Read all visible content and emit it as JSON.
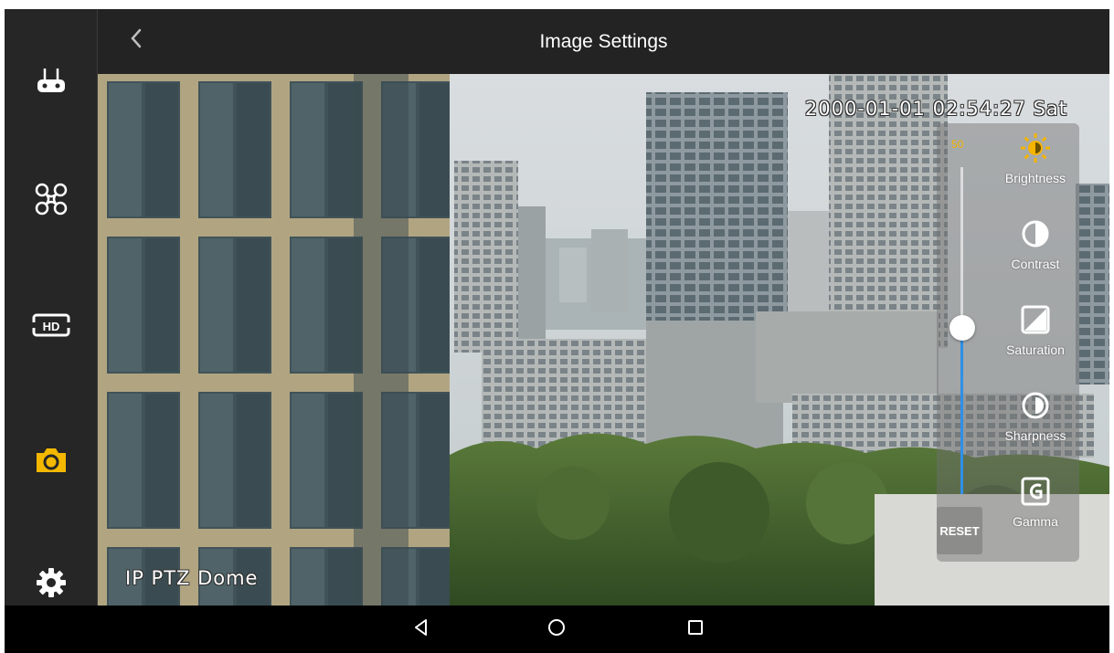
{
  "header": {
    "title": "Image Settings"
  },
  "camera": {
    "timestamp": "2000-01-01 02:54:27 Sat",
    "name": "IP PTZ Dome"
  },
  "sidebar": {
    "items": [
      {
        "icon": "remote-controller-icon",
        "active": false
      },
      {
        "icon": "drone-icon",
        "active": false
      },
      {
        "icon": "hd-icon",
        "active": false
      },
      {
        "icon": "camera-icon",
        "active": true
      },
      {
        "icon": "gear-icon",
        "active": false
      }
    ],
    "active_color": "#f5b800",
    "icon_color": "#ffffff"
  },
  "settings": {
    "slider_value": "50",
    "slider_fraction": 0.5,
    "reset_label": "RESET",
    "options": [
      {
        "label": "Brightness",
        "icon": "brightness-icon",
        "selected": true
      },
      {
        "label": "Contrast",
        "icon": "contrast-icon",
        "selected": false
      },
      {
        "label": "Saturation",
        "icon": "saturation-icon",
        "selected": false
      },
      {
        "label": "Sharpness",
        "icon": "sharpness-icon",
        "selected": false
      },
      {
        "label": "Gamma",
        "icon": "gamma-icon",
        "selected": false
      }
    ],
    "accent_color": "#f4b400",
    "slider_color": "#2f8fe8"
  },
  "navbar": {
    "buttons": [
      {
        "icon": "nav-back-icon"
      },
      {
        "icon": "nav-home-icon"
      },
      {
        "icon": "nav-recents-icon"
      }
    ]
  }
}
